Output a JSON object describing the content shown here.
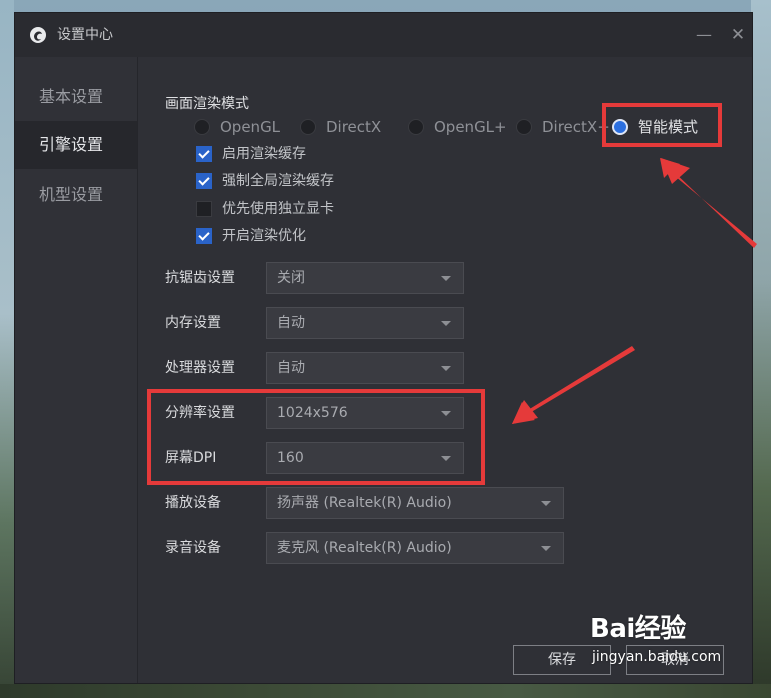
{
  "window": {
    "title": "设置中心",
    "minimize_glyph": "—",
    "close_glyph": "✕"
  },
  "sidebar": {
    "items": [
      {
        "label": "基本设置",
        "active": false
      },
      {
        "label": "引擎设置",
        "active": true
      },
      {
        "label": "机型设置",
        "active": false
      }
    ]
  },
  "render_mode": {
    "title": "画面渲染模式",
    "options": [
      {
        "label": "OpenGL",
        "checked": false
      },
      {
        "label": "DirectX",
        "checked": false
      },
      {
        "label": "OpenGL+",
        "checked": false
      },
      {
        "label": "DirectX+",
        "checked": false
      },
      {
        "label": "智能模式",
        "checked": true
      }
    ]
  },
  "checkboxes": [
    {
      "label": "启用渲染缓存",
      "checked": true
    },
    {
      "label": "强制全局渲染缓存",
      "checked": true
    },
    {
      "label": "优先使用独立显卡",
      "checked": false
    },
    {
      "label": "开启渲染优化",
      "checked": true
    }
  ],
  "settings": {
    "antialias": {
      "label": "抗锯齿设置",
      "value": "关闭"
    },
    "memory": {
      "label": "内存设置",
      "value": "自动"
    },
    "cpu": {
      "label": "处理器设置",
      "value": "自动"
    },
    "resolution": {
      "label": "分辨率设置",
      "value": "1024x576"
    },
    "dpi": {
      "label": "屏幕DPI",
      "value": "160"
    },
    "playback": {
      "label": "播放设备",
      "value": "扬声器 (Realtek(R) Audio)"
    },
    "record": {
      "label": "录音设备",
      "value": "麦克风 (Realtek(R) Audio)"
    }
  },
  "buttons": {
    "save": "保存",
    "cancel": "取消"
  },
  "watermark": {
    "logo": "Bai经验",
    "url": "jingyan.baidu.com"
  },
  "colors": {
    "annotation_red": "#e53a3a",
    "accent_blue": "#2b6fe0"
  }
}
